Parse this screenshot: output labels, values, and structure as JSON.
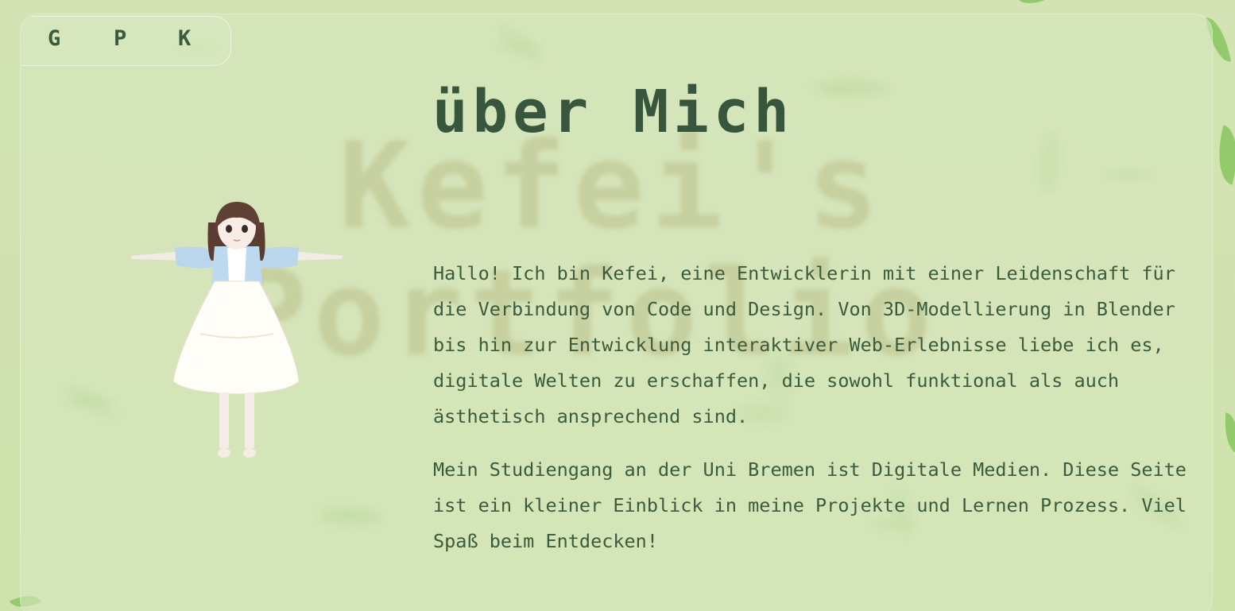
{
  "nav": {
    "items": [
      "G",
      "P",
      "K"
    ]
  },
  "background_watermark": [
    "Kefei's",
    "Portfolio"
  ],
  "about": {
    "heading": "über Mich",
    "paragraph1": "Hallo! Ich bin Kefei, eine Entwicklerin mit einer Leidenschaft für die Verbindung von Code und Design. Von 3D-Modellierung in Blender bis hin zur Entwicklung interaktiver Web-Erlebnisse liebe ich es, digitale Welten zu erschaffen, die sowohl funktional als auch ästhetisch ansprechend sind.",
    "paragraph2": "Mein Studiengang an der Uni Bremen ist Digitale Medien. Diese Seite ist ein kleiner Einblick in meine Projekte und Lernen Prozess. Viel Spaß beim Entdecken!"
  },
  "avatar": {
    "icon": "anime-character-t-pose-icon"
  },
  "colors": {
    "background": "#cfe1ae",
    "text": "#3b5b3d",
    "heading": "#38553d",
    "leaf": "#8cc864"
  }
}
